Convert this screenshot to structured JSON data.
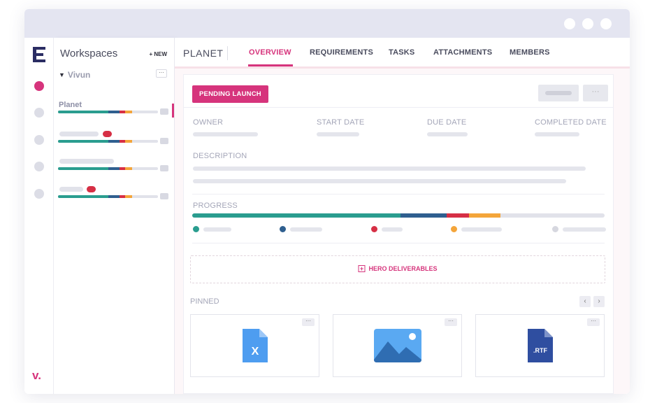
{
  "brand": {
    "accent": "#d6347c",
    "logo_icon": "e-logo-icon",
    "footer_logo": "v."
  },
  "sidebar": {
    "title": "Workspaces",
    "new_button": "+ NEW",
    "workspace": "Vivun",
    "more_button": "···",
    "items": [
      {
        "label": "Planet"
      },
      {
        "label": ""
      },
      {
        "label": ""
      },
      {
        "label": ""
      }
    ]
  },
  "topnav": {
    "project": "PLANET",
    "tabs": [
      {
        "label": "OVERVIEW",
        "active": true
      },
      {
        "label": "REQUIREMENTS"
      },
      {
        "label": "TASKS"
      },
      {
        "label": "ATTACHMENTS"
      },
      {
        "label": "MEMBERS"
      }
    ]
  },
  "overview": {
    "status_badge": "PENDING LAUNCH",
    "more_button": "···",
    "fields": {
      "owner": "OWNER",
      "start_date": "START DATE",
      "due_date": "DUE DATE",
      "completed_date": "COMPLETED DATE",
      "description": "DESCRIPTION",
      "progress": "PROGRESS"
    },
    "progress_colors": [
      "#2a9d8f",
      "#2f5f8f",
      "#d62f45",
      "#f4a53a",
      "#d6d7df"
    ],
    "hero_deliverables": "HERO DELIVERABLES",
    "pinned_label": "PINNED",
    "pager_prev": "‹",
    "pager_next": "›",
    "pinned": [
      {
        "type": "excel-file-icon",
        "text": "X"
      },
      {
        "type": "image-file-icon",
        "text": ""
      },
      {
        "type": "rtf-file-icon",
        "text": ".RTF"
      }
    ]
  }
}
